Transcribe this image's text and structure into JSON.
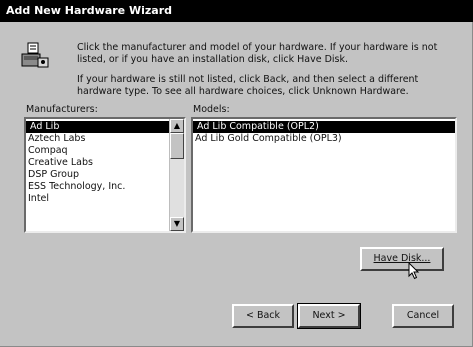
{
  "window": {
    "title": "Add New Hardware Wizard"
  },
  "instructions": {
    "line1": "Click the manufacturer and model of your hardware. If your hardware is not",
    "line2": "listed, or if you have an installation disk, click Have Disk.",
    "line3": "If your hardware is still not listed, click Back, and then select a different",
    "line4": "hardware type. To see all hardware choices, click Unknown Hardware."
  },
  "manufacturers": {
    "label": "Manufacturers:",
    "items": [
      "Ad Lib",
      "Aztech Labs",
      "Compaq",
      "Creative Labs",
      "DSP Group",
      "ESS Technology, Inc.",
      "Intel"
    ],
    "selected": "Ad Lib"
  },
  "models": {
    "label": "Models:",
    "items": [
      "Ad Lib Compatible (OPL2)",
      "Ad Lib Gold Compatible (OPL3)"
    ],
    "selected": "Ad Lib Compatible (OPL2)"
  },
  "buttons": {
    "have_disk": "Have Disk...",
    "back": "< Back",
    "next": "Next >",
    "cancel": "Cancel"
  },
  "icons": {
    "wizard": "hardware-wizard-icon",
    "cursor": "mouse-pointer-icon"
  }
}
